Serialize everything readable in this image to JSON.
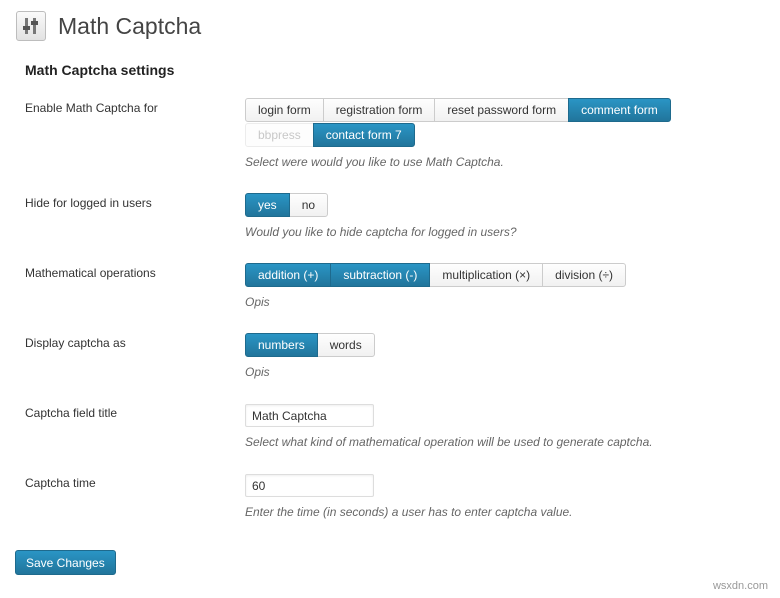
{
  "header": {
    "title": "Math Captcha"
  },
  "section_title": "Math Captcha settings",
  "rows": {
    "enable": {
      "label": "Enable Math Captcha for",
      "options": [
        "login form",
        "registration form",
        "reset password form",
        "comment form"
      ],
      "options_row2": [
        "bbpress",
        "contact form 7"
      ],
      "description": "Select were would you like to use Math Captcha."
    },
    "hide": {
      "label": "Hide for logged in users",
      "options": [
        "yes",
        "no"
      ],
      "description": "Would you like to hide captcha for logged in users?"
    },
    "operations": {
      "label": "Mathematical operations",
      "options": [
        "addition (+)",
        "subtraction (-)",
        "multiplication (×)",
        "division (÷)"
      ],
      "description": "Opis"
    },
    "display": {
      "label": "Display captcha as",
      "options": [
        "numbers",
        "words"
      ],
      "description": "Opis"
    },
    "field_title": {
      "label": "Captcha field title",
      "value": "Math Captcha",
      "description": "Select what kind of mathematical operation will be used to generate captcha."
    },
    "time": {
      "label": "Captcha time",
      "value": "60",
      "description": "Enter the time (in seconds) a user has to enter captcha value."
    }
  },
  "save_label": "Save Changes",
  "watermark": "wsxdn.com",
  "colors": {
    "accent": "#21759b",
    "accent_border": "#1e6a8d"
  }
}
